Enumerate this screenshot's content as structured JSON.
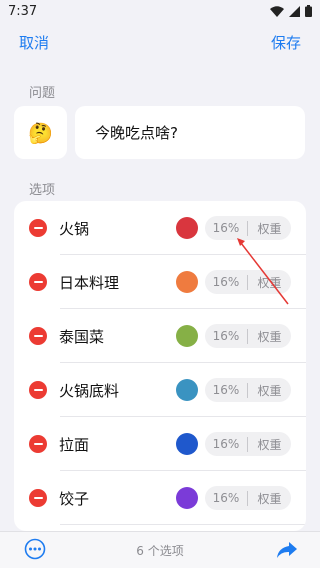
{
  "status_bar": {
    "time": "7:37"
  },
  "nav": {
    "cancel_label": "取消",
    "save_label": "保存"
  },
  "question": {
    "section_label": "问题",
    "emoji": "🤔",
    "text": "今晚吃点啥?"
  },
  "options": {
    "section_label": "选项",
    "weight_label": "权重",
    "items": [
      {
        "name": "火锅",
        "color": "#d9363e",
        "percent": "16%"
      },
      {
        "name": "日本料理",
        "color": "#ef7b3f",
        "percent": "16%"
      },
      {
        "name": "泰国菜",
        "color": "#86b046",
        "percent": "16%"
      },
      {
        "name": "火锅底料",
        "color": "#3a93c1",
        "percent": "16%"
      },
      {
        "name": "拉面",
        "color": "#1f58cc",
        "percent": "16%"
      },
      {
        "name": "饺子",
        "color": "#7b3bd8",
        "percent": "16%"
      }
    ]
  },
  "bottom_bar": {
    "count_text": "6 个选项"
  },
  "colors": {
    "accent": "#1e7cf0",
    "remove": "#ec3b33",
    "annotation": "#e53935"
  }
}
